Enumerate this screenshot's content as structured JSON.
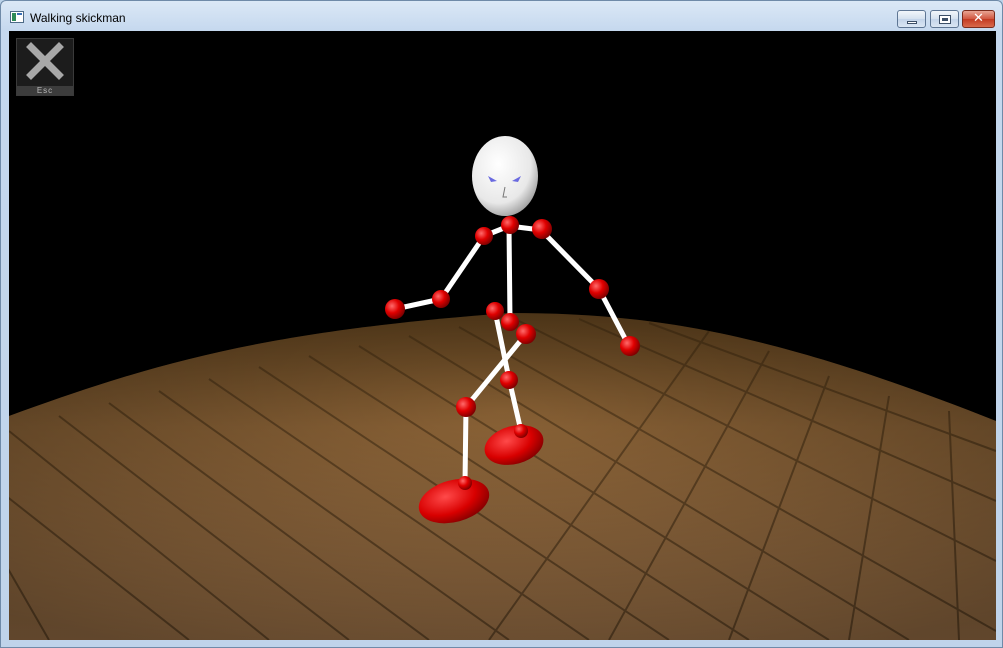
{
  "window": {
    "title": "Walking skickman",
    "controls": {
      "minimize": "minimize-icon",
      "maximize": "maximize-icon",
      "close": "close-icon"
    }
  },
  "overlay": {
    "esc_button": {
      "icon": "close-x-icon",
      "label": "Esc"
    }
  },
  "colors": {
    "background": "#000000",
    "joint": "#e00000",
    "bone": "#ffffff",
    "head": "#f2f2f2",
    "floor": "#9a7040"
  }
}
